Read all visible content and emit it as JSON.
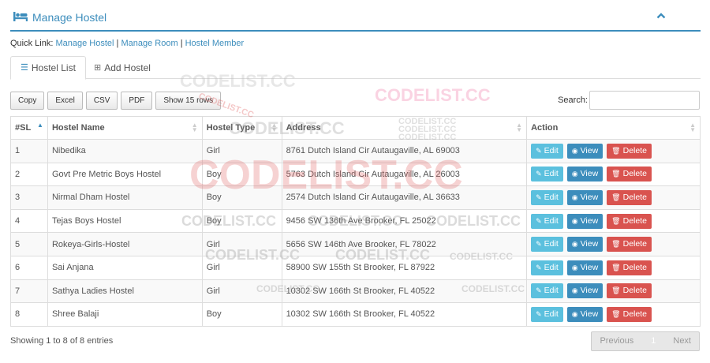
{
  "header": {
    "title": "Manage Hostel"
  },
  "quick_link": {
    "label": "Quick Link:",
    "links": [
      "Manage Hostel",
      "Manage Room",
      "Hostel Member"
    ],
    "separator": "|"
  },
  "tabs": [
    {
      "label": "Hostel List",
      "active": true
    },
    {
      "label": "Add Hostel",
      "active": false
    }
  ],
  "buttons": [
    "Copy",
    "Excel",
    "CSV",
    "PDF",
    "Show 15 rows"
  ],
  "search": {
    "label": "Search:",
    "value": ""
  },
  "table": {
    "columns": [
      "#SL",
      "Hostel Name",
      "Hostel Type",
      "Address",
      "Action"
    ],
    "rows": [
      [
        "1",
        "Nibedika",
        "Girl",
        "8761 Dutch Island Cir Autaugaville, AL 69003"
      ],
      [
        "2",
        "Govt Pre Metric Boys Hostel",
        "Boy",
        "5763 Dutch Island Cir Autaugaville, AL 26003"
      ],
      [
        "3",
        "Nirmal Dham Hostel",
        "Boy",
        "2574 Dutch Island Cir Autaugaville, AL 36633"
      ],
      [
        "4",
        "Tejas Boys Hostel",
        "Boy",
        "9456 SW 136th Ave Brooker, FL 25022"
      ],
      [
        "5",
        "Rokeya-Girls-Hostel",
        "Girl",
        "5656 SW 146th Ave Brooker, FL 78022"
      ],
      [
        "6",
        "Sai Anjana",
        "Girl",
        "58900 SW 155th St Brooker, FL 87922"
      ],
      [
        "7",
        "Sathya Ladies Hostel",
        "Girl",
        "10302 SW 166th St Brooker, FL 40522"
      ],
      [
        "8",
        "Shree Balaji",
        "Boy",
        "10302 SW 166th St Brooker, FL 40522"
      ]
    ],
    "actions": [
      "Edit",
      "View",
      "Delete"
    ]
  },
  "footer": {
    "info": "Showing 1 to 8 of 8 entries",
    "pager": [
      "Previous",
      "1",
      "Next"
    ]
  },
  "watermark": "CODELIST.CC",
  "colors": {
    "primary": "#3c8dbc",
    "edit": "#5bc0de",
    "delete": "#d9534f"
  }
}
